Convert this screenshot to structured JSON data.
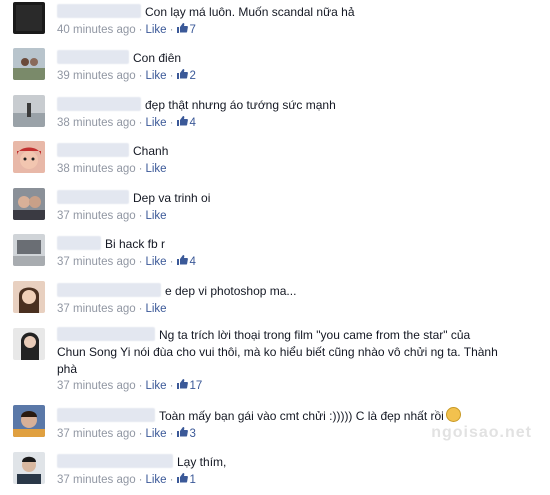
{
  "comments": [
    {
      "text": "Con lạy má luôn. Muốn scandal nữa hả",
      "time": "40 minutes ago",
      "like_label": "Like",
      "like_count": "7"
    },
    {
      "text": "Con điên",
      "time": "39 minutes ago",
      "like_label": "Like",
      "like_count": "2"
    },
    {
      "text": "đẹp thật nhưng áo tướng sức mạnh",
      "time": "38 minutes ago",
      "like_label": "Like",
      "like_count": "4"
    },
    {
      "text": "Chanh",
      "time": "38 minutes ago",
      "like_label": "Like",
      "like_count": ""
    },
    {
      "text": "Dep va trinh oi",
      "time": "37 minutes ago",
      "like_label": "Like",
      "like_count": ""
    },
    {
      "text": "Bi hack fb r",
      "time": "37 minutes ago",
      "like_label": "Like",
      "like_count": "4"
    },
    {
      "text": "e dep vi photoshop ma...",
      "time": "37 minutes ago",
      "like_label": "Like",
      "like_count": ""
    },
    {
      "text": "Ng ta trích lời thoại trong film \"you came from the star\" của",
      "text2": "Chun Song Yi nói đùa cho vui thôi, mà ko hiểu biết cũng nhào vô chửi ng ta. Thành",
      "text3": "phà",
      "time": "37 minutes ago",
      "like_label": "Like",
      "like_count": "17"
    },
    {
      "text": "Toàn mấy bạn gái vào cmt chửi :))))) C là đẹp nhất rồi",
      "time": "37 minutes ago",
      "like_label": "Like",
      "like_count": "3"
    },
    {
      "text": "Lạy thím,",
      "time": "37 minutes ago",
      "like_label": "Like",
      "like_count": "1"
    }
  ],
  "separator": "·",
  "watermark": "ngoisao.net",
  "colors": {
    "link": "#3b5998",
    "meta": "#9197a3",
    "text": "#141823"
  }
}
